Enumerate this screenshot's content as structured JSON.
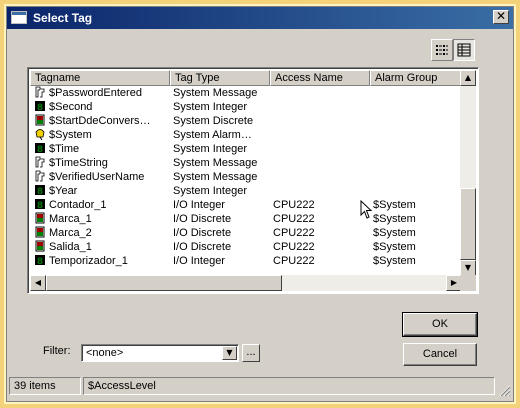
{
  "window": {
    "title": "Select Tag",
    "close_glyph": "✕"
  },
  "toolbar": {
    "list_view_icon": "list-view-icon",
    "details_view_icon": "details-view-icon"
  },
  "columns": [
    "Tagname",
    "Tag Type",
    "Access Name",
    "Alarm Group"
  ],
  "rows": [
    {
      "icon": "message",
      "name": "$PasswordEntered",
      "type": "System Message",
      "access": "",
      "alarm": ""
    },
    {
      "icon": "integer",
      "name": "$Second",
      "type": "System Integer",
      "access": "",
      "alarm": ""
    },
    {
      "icon": "discrete",
      "name": "$StartDdeConvers…",
      "type": "System Discrete",
      "access": "",
      "alarm": ""
    },
    {
      "icon": "alarm",
      "name": "$System",
      "type": "System Alarm…",
      "access": "",
      "alarm": ""
    },
    {
      "icon": "integer",
      "name": "$Time",
      "type": "System Integer",
      "access": "",
      "alarm": ""
    },
    {
      "icon": "message",
      "name": "$TimeString",
      "type": "System Message",
      "access": "",
      "alarm": ""
    },
    {
      "icon": "message",
      "name": "$VerifiedUserName",
      "type": "System Message",
      "access": "",
      "alarm": ""
    },
    {
      "icon": "integer",
      "name": "$Year",
      "type": "System Integer",
      "access": "",
      "alarm": ""
    },
    {
      "icon": "integer",
      "name": "Contador_1",
      "type": "I/O Integer",
      "access": "CPU222",
      "alarm": "$System"
    },
    {
      "icon": "discrete",
      "name": "Marca_1",
      "type": "I/O Discrete",
      "access": "CPU222",
      "alarm": "$System"
    },
    {
      "icon": "discrete",
      "name": "Marca_2",
      "type": "I/O Discrete",
      "access": "CPU222",
      "alarm": "$System"
    },
    {
      "icon": "discrete",
      "name": "Salida_1",
      "type": "I/O Discrete",
      "access": "CPU222",
      "alarm": "$System"
    },
    {
      "icon": "integer",
      "name": "Temporizador_1",
      "type": "I/O Integer",
      "access": "CPU222",
      "alarm": "$System"
    }
  ],
  "buttons": {
    "ok": "OK",
    "cancel": "Cancel",
    "browse": "..."
  },
  "filter": {
    "label": "Filter:",
    "value": "<none>"
  },
  "status": {
    "count": "39 items",
    "selected": "$AccessLevel"
  },
  "colors": {
    "title_start": "#0a246a",
    "title_end": "#3a6ea5",
    "integer_icon": "#008000",
    "discrete_icon": "#a00000",
    "alarm_icon": "#f0d000"
  }
}
